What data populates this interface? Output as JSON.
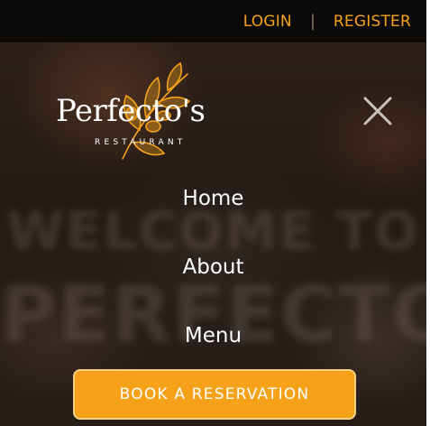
{
  "topbar": {
    "login_label": "LOGIN",
    "separator": "|",
    "register_label": "REGISTER"
  },
  "hero": {
    "background_text_line1": "WELCOME TO",
    "background_text_line2": "PERFECTO'S"
  },
  "logo": {
    "name": "Perfecto's",
    "subtitle": "RESTAURANT",
    "icon": "olive-branch-icon"
  },
  "menu": {
    "close_icon": "close-icon",
    "items": [
      {
        "label": "Home"
      },
      {
        "label": "About"
      },
      {
        "label": "Menu"
      }
    ]
  },
  "cta": {
    "reserve_label": "BOOK A RESERVATION"
  },
  "colors": {
    "accent": "#f5a21a",
    "topbar_bg": "#0c0a09",
    "text": "#ffffff"
  }
}
